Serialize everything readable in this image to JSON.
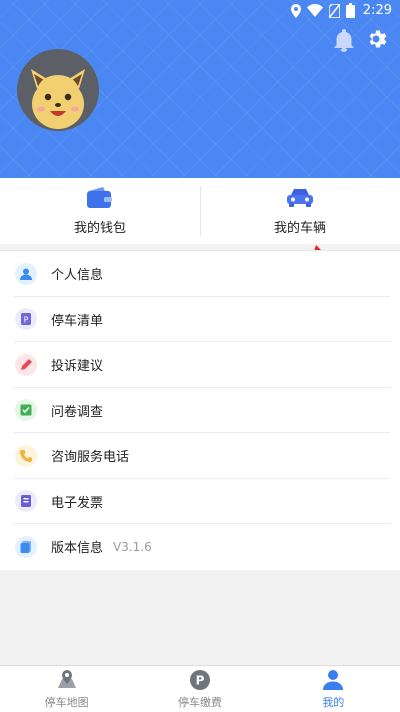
{
  "status_bar": {
    "time": "2:29"
  },
  "colors": {
    "header_blue": "#4b87f2",
    "accent": "#3a7ef0",
    "arrow_red": "#e8222a"
  },
  "header_icons": [
    "bell-icon",
    "gear-icon"
  ],
  "quick_actions": [
    {
      "label": "我的钱包",
      "icon": "wallet-icon"
    },
    {
      "label": "我的车辆",
      "icon": "car-icon"
    }
  ],
  "menu": [
    {
      "label": "个人信息",
      "icon": "user-info-icon"
    },
    {
      "label": "停车清单",
      "icon": "parking-list-icon"
    },
    {
      "label": "投诉建议",
      "icon": "complaint-icon"
    },
    {
      "label": "问卷调查",
      "icon": "survey-icon"
    },
    {
      "label": "咨询服务电话",
      "icon": "phone-icon"
    },
    {
      "label": "电子发票",
      "icon": "invoice-icon"
    },
    {
      "label": "版本信息",
      "icon": "version-icon",
      "version": "V3.1.6"
    }
  ],
  "bottom_nav": [
    {
      "label": "停车地图",
      "icon": "map-pin-icon",
      "active": false
    },
    {
      "label": "停车缴费",
      "icon": "parking-p-icon",
      "active": false
    },
    {
      "label": "我的",
      "icon": "person-icon",
      "active": true
    }
  ]
}
